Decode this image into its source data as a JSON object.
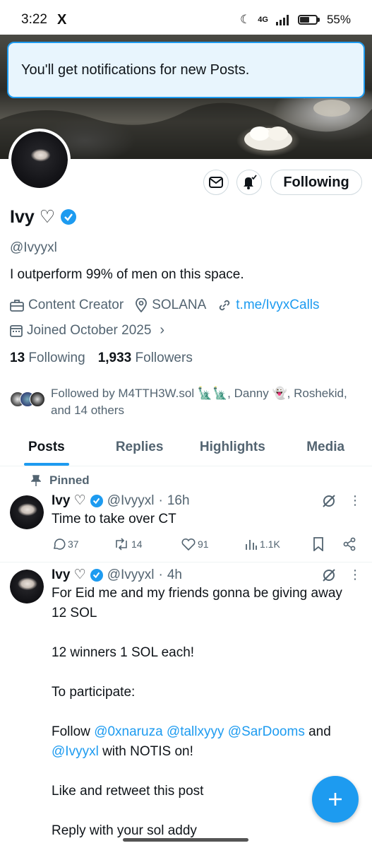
{
  "status_bar": {
    "time": "3:22",
    "app_icon": "X",
    "network": "4G",
    "battery": "55%",
    "battery_level": 0.55
  },
  "toast": {
    "text": "You'll get notifications for new Posts."
  },
  "profile": {
    "name": "Ivy ♡",
    "handle": "@Ivyyxl",
    "bio": "I outperform 99% of men on this space.",
    "category": "Content Creator",
    "location": "SOLANA",
    "link": "t.me/IvyxCalls",
    "joined": "Joined October 2025",
    "following_count": "13",
    "following_label": "Following",
    "followers_count": "1,933",
    "followers_label": "Followers",
    "followed_by": "Followed by M4TTH3W.sol 🗽🗽, Danny 👻, Roshekid, and 14 others"
  },
  "buttons": {
    "following": "Following",
    "message_icon": "envelope-icon",
    "bell_icon": "bell-check-icon"
  },
  "tabs": [
    {
      "label": "Posts",
      "active": true
    },
    {
      "label": "Replies",
      "active": false
    },
    {
      "label": "Highlights",
      "active": false
    },
    {
      "label": "Media",
      "active": false
    }
  ],
  "pinned_label": "Pinned",
  "tweets": [
    {
      "name": "Ivy ♡",
      "handle": "@Ivyyxl",
      "time": "16h",
      "text": "Time to take over CT",
      "replies": "37",
      "reposts": "14",
      "likes": "91",
      "views": "1.1K"
    },
    {
      "name": "Ivy ♡",
      "handle": "@Ivyyxl",
      "time": "4h",
      "lines": {
        "l1": "For Eid me and my friends gonna be giving away",
        "l2": "12 SOL",
        "l3": "12 winners 1 SOL each!",
        "l4": "To participate:",
        "l5_pre": "Follow ",
        "m1": "@0xnaruza",
        "m2": "@tallxyyy",
        "m3": "@SarDooms",
        "l5_post": " and",
        "m4": "@Ivyyxl",
        "l6_post": " with NOTIS on!",
        "l7": "Like and retweet this post",
        "l8": "Reply with your sol addy"
      }
    }
  ],
  "colors": {
    "accent": "#1d9bf0",
    "muted": "#536471",
    "text": "#0f1419"
  }
}
